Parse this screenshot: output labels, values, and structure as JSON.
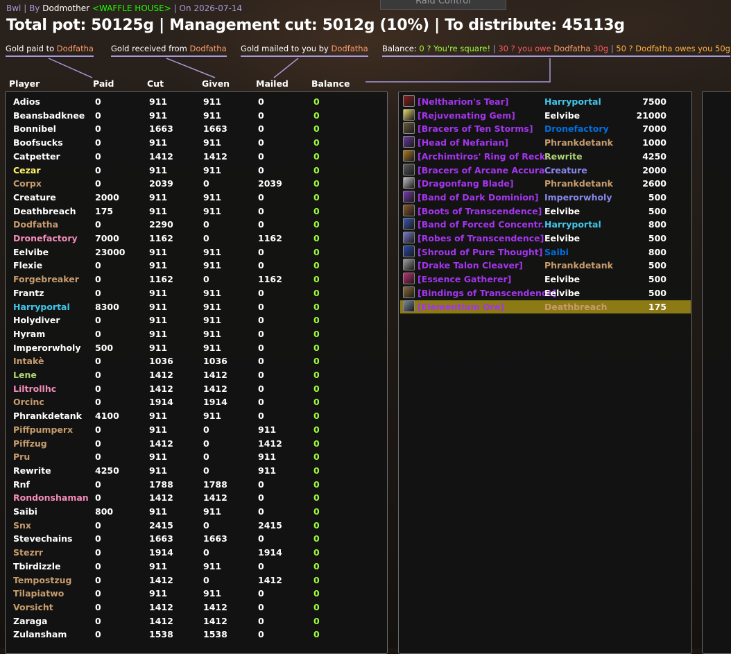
{
  "header": {
    "raid": "Bwl",
    "by_label": "By",
    "author": "Dodmother",
    "guild": "<WAFFLE HOUSE>",
    "date": "On 2026-07-14",
    "tab_label": "Raid Control",
    "summary": "Total pot: 50125g | Management cut: 5012g (10%) | To distribute: 45113g"
  },
  "legend": {
    "paid_label": "Gold paid to",
    "received_label": "Gold received from",
    "mailed_label": "Gold mailed to you by",
    "name": "Dodfatha",
    "balance_label": "Balance:",
    "square": "0 ? You're square!",
    "owe_prefix": "30 ? you owe",
    "owe_amount": "30g",
    "owed_prefix": "50 ? Dodfatha owes you",
    "owed_amount": "50g"
  },
  "columns": [
    "Player",
    "Paid",
    "Cut",
    "Given",
    "Mailed",
    "Balance"
  ],
  "colors": {
    "white": "#ffffff",
    "yellow": "#fff569",
    "tan": "#c79c6e",
    "pink": "#f58cba",
    "blue": "#40c7eb",
    "green": "#abd473",
    "dark_blue": "#0070de",
    "purple": "#8787ed",
    "balance_zero": "#9fff3a",
    "epic": "#a335ee",
    "highlight": "#8c7a14"
  },
  "players": [
    {
      "name": "Adios",
      "color": "white",
      "paid": "0",
      "cut": "911",
      "given": "911",
      "mailed": "0",
      "balance": "0"
    },
    {
      "name": "Beansbadknee",
      "color": "white",
      "paid": "0",
      "cut": "911",
      "given": "911",
      "mailed": "0",
      "balance": "0"
    },
    {
      "name": "Bonnibel",
      "color": "white",
      "paid": "0",
      "cut": "1663",
      "given": "1663",
      "mailed": "0",
      "balance": "0"
    },
    {
      "name": "Boofsucks",
      "color": "white",
      "paid": "0",
      "cut": "911",
      "given": "911",
      "mailed": "0",
      "balance": "0"
    },
    {
      "name": "Catpetter",
      "color": "white",
      "paid": "0",
      "cut": "1412",
      "given": "1412",
      "mailed": "0",
      "balance": "0"
    },
    {
      "name": "Cezar",
      "color": "yellow",
      "paid": "0",
      "cut": "911",
      "given": "911",
      "mailed": "0",
      "balance": "0"
    },
    {
      "name": "Corpx",
      "color": "tan",
      "paid": "0",
      "cut": "2039",
      "given": "0",
      "mailed": "2039",
      "balance": "0"
    },
    {
      "name": "Creature",
      "color": "white",
      "paid": "2000",
      "cut": "911",
      "given": "911",
      "mailed": "0",
      "balance": "0"
    },
    {
      "name": "Deathbreach",
      "color": "white",
      "paid": "175",
      "cut": "911",
      "given": "911",
      "mailed": "0",
      "balance": "0"
    },
    {
      "name": "Dodfatha",
      "color": "tan",
      "paid": "0",
      "cut": "2290",
      "given": "0",
      "mailed": "0",
      "balance": "0"
    },
    {
      "name": "Dronefactory",
      "color": "pink",
      "paid": "7000",
      "cut": "1162",
      "given": "0",
      "mailed": "1162",
      "balance": "0"
    },
    {
      "name": "Eelvibe",
      "color": "white",
      "paid": "23000",
      "cut": "911",
      "given": "911",
      "mailed": "0",
      "balance": "0"
    },
    {
      "name": "Flexie",
      "color": "white",
      "paid": "0",
      "cut": "911",
      "given": "911",
      "mailed": "0",
      "balance": "0"
    },
    {
      "name": "Forgebreaker",
      "color": "tan",
      "paid": "0",
      "cut": "1162",
      "given": "0",
      "mailed": "1162",
      "balance": "0"
    },
    {
      "name": "Frantz",
      "color": "white",
      "paid": "0",
      "cut": "911",
      "given": "911",
      "mailed": "0",
      "balance": "0"
    },
    {
      "name": "Harryportal",
      "color": "blue",
      "paid": "8300",
      "cut": "911",
      "given": "911",
      "mailed": "0",
      "balance": "0"
    },
    {
      "name": "Holydiver",
      "color": "white",
      "paid": "0",
      "cut": "911",
      "given": "911",
      "mailed": "0",
      "balance": "0"
    },
    {
      "name": "Hyram",
      "color": "white",
      "paid": "0",
      "cut": "911",
      "given": "911",
      "mailed": "0",
      "balance": "0"
    },
    {
      "name": "Imperorwholy",
      "color": "white",
      "paid": "500",
      "cut": "911",
      "given": "911",
      "mailed": "0",
      "balance": "0"
    },
    {
      "name": "Intakè",
      "color": "tan",
      "paid": "0",
      "cut": "1036",
      "given": "1036",
      "mailed": "0",
      "balance": "0"
    },
    {
      "name": "Lene",
      "color": "green",
      "paid": "0",
      "cut": "1412",
      "given": "1412",
      "mailed": "0",
      "balance": "0"
    },
    {
      "name": "Liltrollhc",
      "color": "pink",
      "paid": "0",
      "cut": "1412",
      "given": "1412",
      "mailed": "0",
      "balance": "0"
    },
    {
      "name": "Orcinc",
      "color": "tan",
      "paid": "0",
      "cut": "1914",
      "given": "1914",
      "mailed": "0",
      "balance": "0"
    },
    {
      "name": "Phrankdetank",
      "color": "white",
      "paid": "4100",
      "cut": "911",
      "given": "911",
      "mailed": "0",
      "balance": "0"
    },
    {
      "name": "Piffpumperx",
      "color": "tan",
      "paid": "0",
      "cut": "911",
      "given": "0",
      "mailed": "911",
      "balance": "0"
    },
    {
      "name": "Piffzug",
      "color": "tan",
      "paid": "0",
      "cut": "1412",
      "given": "0",
      "mailed": "1412",
      "balance": "0"
    },
    {
      "name": "Pru",
      "color": "tan",
      "paid": "0",
      "cut": "911",
      "given": "0",
      "mailed": "911",
      "balance": "0"
    },
    {
      "name": "Rewrite",
      "color": "white",
      "paid": "4250",
      "cut": "911",
      "given": "0",
      "mailed": "911",
      "balance": "0"
    },
    {
      "name": "Rnf",
      "color": "white",
      "paid": "0",
      "cut": "1788",
      "given": "1788",
      "mailed": "0",
      "balance": "0"
    },
    {
      "name": "Rondonshaman",
      "color": "pink",
      "paid": "0",
      "cut": "1412",
      "given": "1412",
      "mailed": "0",
      "balance": "0"
    },
    {
      "name": "Saibi",
      "color": "white",
      "paid": "800",
      "cut": "911",
      "given": "911",
      "mailed": "0",
      "balance": "0"
    },
    {
      "name": "Snx",
      "color": "tan",
      "paid": "0",
      "cut": "2415",
      "given": "0",
      "mailed": "2415",
      "balance": "0"
    },
    {
      "name": "Stevechains",
      "color": "white",
      "paid": "0",
      "cut": "1663",
      "given": "1663",
      "mailed": "0",
      "balance": "0"
    },
    {
      "name": "Stezrr",
      "color": "tan",
      "paid": "0",
      "cut": "1914",
      "given": "0",
      "mailed": "1914",
      "balance": "0"
    },
    {
      "name": "Tbirdizzle",
      "color": "white",
      "paid": "0",
      "cut": "911",
      "given": "911",
      "mailed": "0",
      "balance": "0"
    },
    {
      "name": "Tempostzug",
      "color": "tan",
      "paid": "0",
      "cut": "1412",
      "given": "0",
      "mailed": "1412",
      "balance": "0"
    },
    {
      "name": "Tilapiatwo",
      "color": "tan",
      "paid": "0",
      "cut": "911",
      "given": "911",
      "mailed": "0",
      "balance": "0"
    },
    {
      "name": "Vorsicht",
      "color": "tan",
      "paid": "0",
      "cut": "1412",
      "given": "1412",
      "mailed": "0",
      "balance": "0"
    },
    {
      "name": "Zaraga",
      "color": "white",
      "paid": "0",
      "cut": "1412",
      "given": "1412",
      "mailed": "0",
      "balance": "0"
    },
    {
      "name": "Zulansham",
      "color": "white",
      "paid": "0",
      "cut": "1538",
      "given": "1538",
      "mailed": "0",
      "balance": "0"
    }
  ],
  "loot": [
    {
      "item": "[Neltharion's Tear]",
      "icon": "necklace-icon",
      "icon_color": "#8a1f1f",
      "winner": "Harryportal",
      "winner_color": "blue",
      "amount": "7500"
    },
    {
      "item": "[Rejuvenating Gem]",
      "icon": "gem-icon",
      "icon_color": "#e8d86a",
      "winner": "Eelvibe",
      "winner_color": "white",
      "amount": "21000"
    },
    {
      "item": "[Bracers of Ten Storms]",
      "icon": "bracers-icon",
      "icon_color": "#6a5a3a",
      "winner": "Dronefactory",
      "winner_color": "dark_blue",
      "amount": "7000"
    },
    {
      "item": "[Head of Nefarian]",
      "icon": "dragon-head-icon",
      "icon_color": "#6a3aa0",
      "winner": "Phrankdetank",
      "winner_color": "tan",
      "amount": "1000"
    },
    {
      "item": "[Archimtiros' Ring of Reck...",
      "icon": "ring-icon",
      "icon_color": "#b07a20",
      "winner": "Rewrite",
      "winner_color": "green",
      "amount": "4250"
    },
    {
      "item": "[Bracers of Arcane Accura...",
      "icon": "bracers-icon",
      "icon_color": "#5a5a5a",
      "winner": "Creature",
      "winner_color": "purple",
      "amount": "2000"
    },
    {
      "item": "[Dragonfang Blade]",
      "icon": "dagger-icon",
      "icon_color": "#c0c0c0",
      "winner": "Phrankdetank",
      "winner_color": "tan",
      "amount": "2600"
    },
    {
      "item": "[Band of Dark Dominion]",
      "icon": "ring-icon",
      "icon_color": "#7a3ab0",
      "winner": "Imperorwholy",
      "winner_color": "purple",
      "amount": "500"
    },
    {
      "item": "[Boots of Transcendence]",
      "icon": "boots-icon",
      "icon_color": "#8a5a2a",
      "winner": "Eelvibe",
      "winner_color": "white",
      "amount": "500"
    },
    {
      "item": "[Band of Forced Concentr...",
      "icon": "ring-icon",
      "icon_color": "#3a5ab0",
      "winner": "Harryportal",
      "winner_color": "blue",
      "amount": "800"
    },
    {
      "item": "[Robes of Transcendence]",
      "icon": "robe-icon",
      "icon_color": "#7a7ad0",
      "winner": "Eelvibe",
      "winner_color": "white",
      "amount": "500"
    },
    {
      "item": "[Shroud of Pure Thought]",
      "icon": "cloak-icon",
      "icon_color": "#2a4ab0",
      "winner": "Saibi",
      "winner_color": "dark_blue",
      "amount": "800"
    },
    {
      "item": "[Drake Talon Cleaver]",
      "icon": "axe-icon",
      "icon_color": "#a0a0a0",
      "winner": "Phrankdetank",
      "winner_color": "tan",
      "amount": "500"
    },
    {
      "item": "[Essence Gatherer]",
      "icon": "wand-icon",
      "icon_color": "#c03070",
      "winner": "Eelvibe",
      "winner_color": "white",
      "amount": "500"
    },
    {
      "item": "[Bindings of Transcendence]",
      "icon": "bracers-icon",
      "icon_color": "#8a6a3a",
      "winner": "Eelvibe",
      "winner_color": "white",
      "amount": "500"
    },
    {
      "item": "[Elementium Ore]",
      "icon": "ore-icon",
      "icon_color": "#7a8aa0",
      "winner": "Deathbreach",
      "winner_color": "tan",
      "amount": "175",
      "highlighted": true
    }
  ]
}
